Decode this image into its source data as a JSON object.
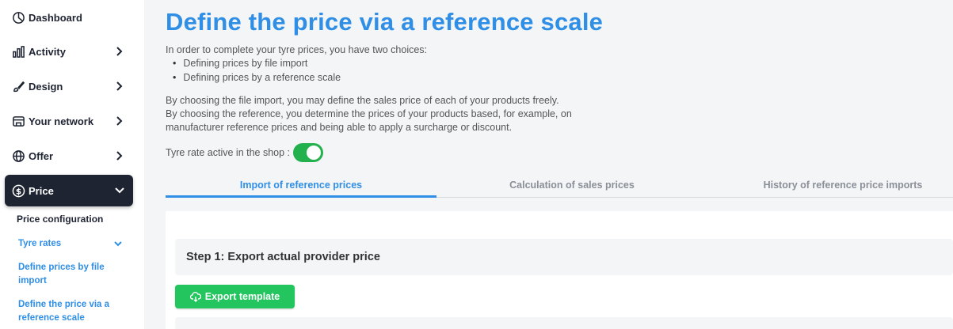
{
  "sidebar": {
    "items": [
      {
        "label": "Dashboard",
        "icon": "dashboard-icon"
      },
      {
        "label": "Activity",
        "icon": "activity-icon"
      },
      {
        "label": "Design",
        "icon": "design-icon"
      },
      {
        "label": "Your network",
        "icon": "network-icon"
      },
      {
        "label": "Offer",
        "icon": "globe-icon"
      },
      {
        "label": "Price",
        "icon": "dollar-icon"
      }
    ],
    "submenu": {
      "title": "Price configuration",
      "items": [
        {
          "label": "Tyre rates"
        },
        {
          "label": "Define prices by file import"
        },
        {
          "label": "Define the price via a reference scale"
        }
      ]
    }
  },
  "main": {
    "title": "Define the price via a reference scale",
    "intro": "In order to complete your tyre prices, you have two choices:",
    "choices": [
      "Defining prices by file import",
      "Defining prices by a reference scale"
    ],
    "paragraph_line1": "By choosing the file import, you may define the sales price of each of your products freely.",
    "paragraph_line2": "By choosing the reference, you determine the prices of your products based, for example, on",
    "paragraph_line3": "manufacturer reference prices and being able to apply a surcharge or discount.",
    "toggle_label": "Tyre rate active in the shop :",
    "toggle_on": true,
    "tabs": [
      {
        "label": "Import of reference prices",
        "active": true
      },
      {
        "label": "Calculation of sales prices",
        "active": false
      },
      {
        "label": "History of reference price imports",
        "active": false
      }
    ],
    "step1_title": "Step 1: Export actual provider price",
    "export_button": "Export template"
  },
  "colors": {
    "accent": "#2f8ee5",
    "sidebar_active": "#1f2433",
    "success": "#22c55e"
  }
}
